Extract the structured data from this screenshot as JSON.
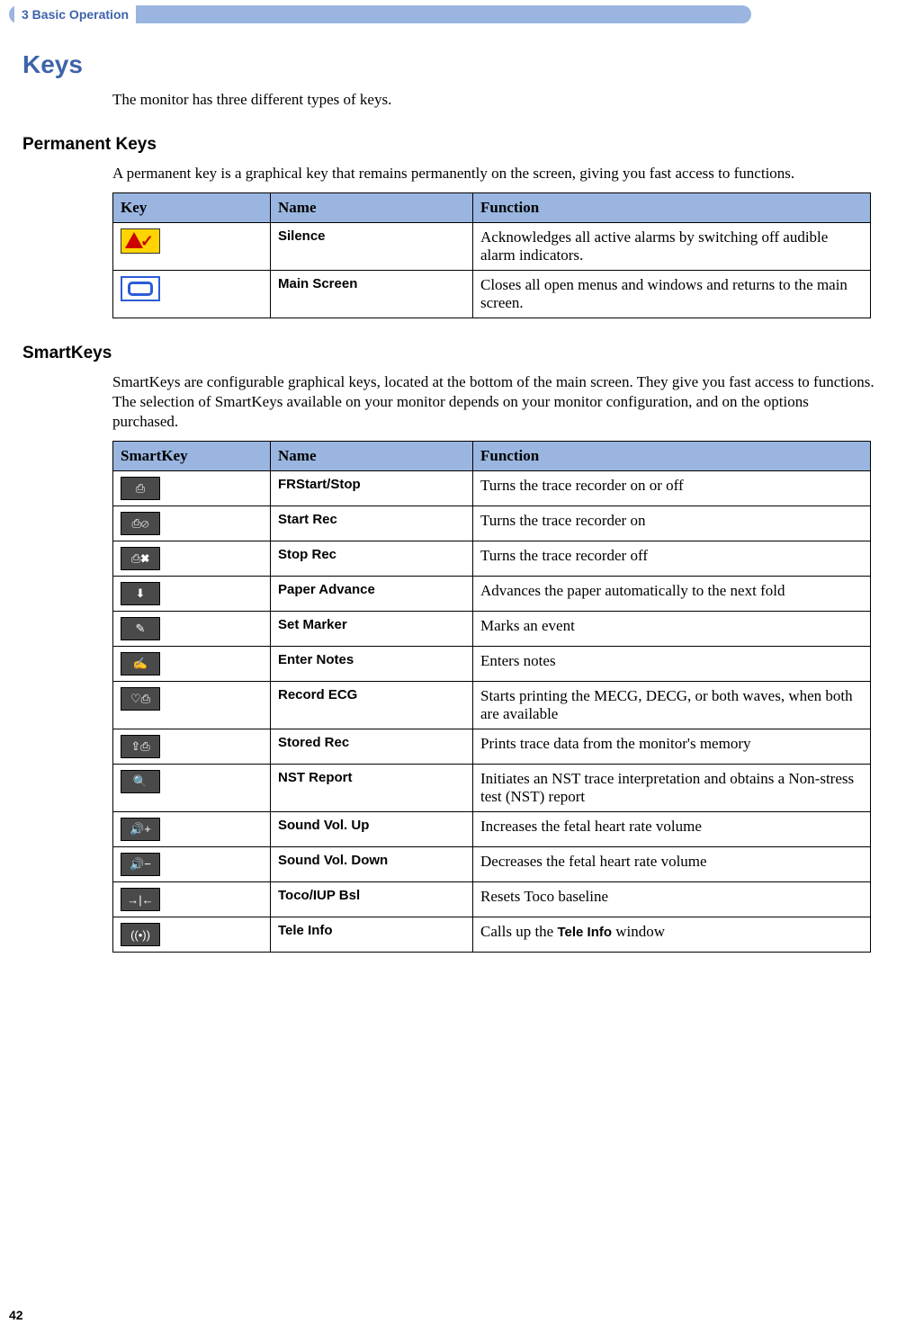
{
  "header": {
    "caption": "3  Basic Operation"
  },
  "page_number": "42",
  "section_title": "Keys",
  "intro": "The monitor has three different types of keys.",
  "permanent": {
    "heading": "Permanent Keys",
    "intro": "A permanent key is a graphical key that remains permanently on the screen, giving you fast access to functions.",
    "table": {
      "h1": "Key",
      "h2": "Name",
      "h3": "Function",
      "rows": [
        {
          "icon": "silence-icon",
          "name": "Silence",
          "func": "Acknowledges all active alarms by switching off audible alarm indicators."
        },
        {
          "icon": "main-screen-icon",
          "name": "Main Screen",
          "func": "Closes all open menus and windows and returns to the main screen."
        }
      ]
    }
  },
  "smartkeys": {
    "heading": "SmartKeys",
    "intro": "SmartKeys are configurable graphical keys, located at the bottom of the main screen. They give you fast access to functions. The selection of SmartKeys available on your monitor depends on your monitor configuration, and on the options purchased.",
    "table": {
      "h1": "SmartKey",
      "h2": "Name",
      "h3": "Function",
      "rows": [
        {
          "glyph": "⎙",
          "name": "FRStart/Stop",
          "func": "Turns the trace recorder on or off"
        },
        {
          "glyph": "⎙⊘",
          "name": "Start Rec",
          "func": "Turns the trace recorder on"
        },
        {
          "glyph": "⎙✖",
          "name": "Stop Rec",
          "func": "Turns the trace recorder off"
        },
        {
          "glyph": "⬇︎",
          "name": "Paper Advance",
          "func": "Advances the paper automatically to the next fold"
        },
        {
          "glyph": "✎",
          "name": "Set Marker",
          "func": "Marks an event"
        },
        {
          "glyph": "✍",
          "name": "Enter Notes",
          "func": "Enters notes"
        },
        {
          "glyph": "♡⎙",
          "name": "Record ECG",
          "func": "Starts printing the MECG, DECG, or both waves, when both are available"
        },
        {
          "glyph": "⇪⎙",
          "name": "Stored Rec",
          "func": "Prints trace data from the monitor's memory"
        },
        {
          "glyph": "🔍",
          "name": "NST Report",
          "func": "Initiates an NST trace interpretation and obtains a Non-stress test (NST) report"
        },
        {
          "glyph": "🔊+",
          "name": "Sound Vol. Up",
          "func": "Increases the fetal heart rate volume"
        },
        {
          "glyph": "🔊−",
          "name": "Sound Vol. Down",
          "func": "Decreases the fetal heart rate volume"
        },
        {
          "glyph": "→|←",
          "name": "Toco/IUP Bsl",
          "func": "Resets Toco baseline"
        },
        {
          "glyph": "((•))",
          "name": "Tele Info",
          "func_pre": "Calls up the ",
          "func_bold": "Tele Info",
          "func_post": " window"
        }
      ]
    }
  }
}
